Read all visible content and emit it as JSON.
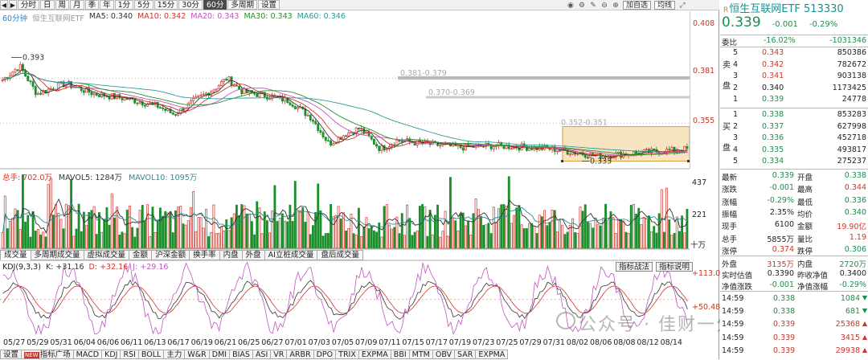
{
  "toolbar": {
    "periods": [
      "分时",
      "日",
      "周",
      "月",
      "季",
      "年",
      "1分",
      "5分",
      "15分",
      "30分",
      "60分",
      "多周期",
      "设置"
    ],
    "active_period": "60分",
    "right_buttons": [
      "加自选",
      "均线"
    ]
  },
  "ma_legend": {
    "period": "60分钟",
    "name": "恒生互联网ETF",
    "ma5": "MA5: 0.340",
    "ma10": "MA10: 0.342",
    "ma20": "MA20: 0.343",
    "ma30": "MA30: 0.343",
    "ma60": "MA60: 0.346"
  },
  "price_axis": [
    "0.408",
    "0.381",
    "0.355"
  ],
  "annotations": {
    "high_label": "0.393",
    "low_label": "0.333",
    "level1": "0.381-0.379",
    "level2": "0.370-0.369",
    "level3": "0.352-0.351"
  },
  "volume": {
    "total": "总手: 702.0万",
    "mavol5": "MAVOL5: 1284万",
    "mavol10": "MAVOL10: 1095万",
    "axis": [
      "437",
      "221",
      "十万"
    ]
  },
  "indicator_tabs": [
    "成交量",
    "多周期成交量",
    "虚拟成交量",
    "金额",
    "沪深金额",
    "换手率",
    "内盘",
    "外盘",
    "AI立桩成交量",
    "盘后成交量"
  ],
  "kdj": {
    "name": "KDJ(9,3,3)",
    "k": "K: +31.16",
    "d": "D: +32.16",
    "j": "J: +29.16",
    "axis": [
      "+113.0",
      "+50.48"
    ],
    "buttons": [
      "指标战法",
      "指标说明"
    ]
  },
  "date_axis": [
    "05/27",
    "05/29",
    "05/31",
    "06/04",
    "06/06",
    "06/11",
    "06/13",
    "06/17",
    "06/19",
    "06/21",
    "06/25",
    "06/27",
    "07/01",
    "07/03",
    "07/05",
    "07/09",
    "07/11",
    "07/15",
    "07/17",
    "07/19",
    "07/23",
    "07/25",
    "07/29",
    "07/31",
    "08/02",
    "08/06",
    "08/08",
    "08/12",
    "08/14"
  ],
  "bottom_tabs": [
    "设置",
    "指标广场",
    "MACD",
    "KDJ",
    "RSI",
    "BOLL",
    "主力",
    "W&R",
    "DMI",
    "BIAS",
    "ASI",
    "VR",
    "ARBR",
    "DPO",
    "TRIX",
    "EXPMA",
    "BBI",
    "MTM",
    "OBV",
    "SAR",
    "EXPMA"
  ],
  "bottom_new_label": "NEW",
  "watermark": "公众号 · 佳财一分钟",
  "quote": {
    "title": "恒生互联网ETF 513330",
    "price": "0.339",
    "change": "-0.001",
    "change_pct": "-0.29%",
    "weibi_label": "委比",
    "weibi_pct": "-16.02%",
    "weibi_val": "-1031346",
    "sell_label": "卖盘",
    "buy_label": "买盘",
    "asks": [
      {
        "lvl": "5",
        "price": "0.343",
        "vol": "850386"
      },
      {
        "lvl": "4",
        "price": "0.342",
        "vol": "782672"
      },
      {
        "lvl": "3",
        "price": "0.341",
        "vol": "903138"
      },
      {
        "lvl": "2",
        "price": "0.340",
        "vol": "1173425"
      },
      {
        "lvl": "1",
        "price": "0.339",
        "vol": "24778"
      }
    ],
    "bids": [
      {
        "lvl": "1",
        "price": "0.338",
        "vol": "853283"
      },
      {
        "lvl": "2",
        "price": "0.337",
        "vol": "627998"
      },
      {
        "lvl": "3",
        "price": "0.336",
        "vol": "452718"
      },
      {
        "lvl": "4",
        "price": "0.335",
        "vol": "493817"
      },
      {
        "lvl": "5",
        "price": "0.334",
        "vol": "275237"
      }
    ],
    "stats": [
      {
        "l1": "最新",
        "v1": "0.339",
        "l2": "开盘",
        "v2": "0.338"
      },
      {
        "l1": "涨跌",
        "v1": "-0.001",
        "l2": "最高",
        "v2": "0.344"
      },
      {
        "l1": "涨幅",
        "v1": "-0.29%",
        "l2": "最低",
        "v2": "0.336"
      },
      {
        "l1": "振幅",
        "v1": "2.35%",
        "l2": "均价",
        "v2": "0.340"
      },
      {
        "l1": "现手",
        "v1": "6100",
        "l2": "金额",
        "v2": "19.90亿"
      },
      {
        "l1": "总手",
        "v1": "5855万",
        "l2": "量比",
        "v2": "1.19"
      },
      {
        "l1": "涨停",
        "v1": "0.374",
        "l2": "跌停",
        "v2": "0.306"
      }
    ],
    "stats2": [
      {
        "l1": "外盘",
        "v1": "3135万",
        "l2": "内盘",
        "v2": "2720万"
      },
      {
        "l1": "实时估值",
        "v1": "0.3390",
        "l2": "昨收净值",
        "v2": "0.3400"
      },
      {
        "l1": "净值涨跌",
        "v1": "-0.001",
        "l2": "净值涨幅",
        "v2": "-0.29%"
      }
    ],
    "ticks": [
      {
        "time": "14:59",
        "price": "0.338",
        "vol": "1084"
      },
      {
        "time": "14:59",
        "price": "0.338",
        "vol": "681"
      },
      {
        "time": "14:59",
        "price": "0.339",
        "vol": "25368"
      },
      {
        "time": "14:59",
        "price": "0.339",
        "vol": "3415"
      },
      {
        "time": "14:59",
        "price": "0.339",
        "vol": "29938"
      }
    ]
  }
}
